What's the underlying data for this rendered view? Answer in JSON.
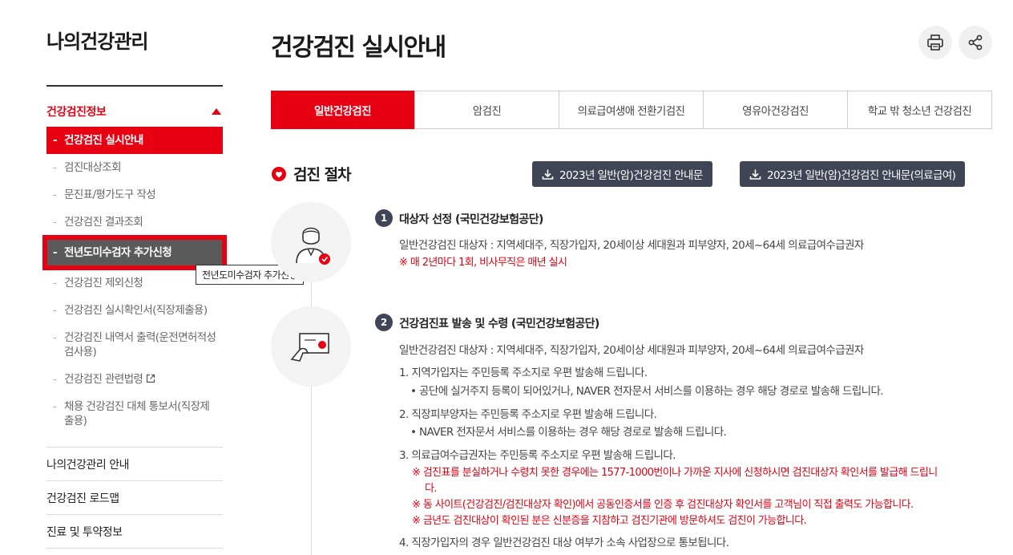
{
  "sidebar": {
    "title": "나의건강관리",
    "section": "건강검진정보",
    "items": [
      {
        "label": "건강검진 실시안내"
      },
      {
        "label": "검진대상조회"
      },
      {
        "label": "문진표/평가도구 작성"
      },
      {
        "label": "건강검진 결과조회"
      },
      {
        "label": "전년도미수검자 추가신청"
      },
      {
        "label": "건강검진 제외신청"
      },
      {
        "label": "건강검진 실시확인서(직장제출용)"
      },
      {
        "label": "건강검진 내역서 출력(운전면허적성검사용)"
      },
      {
        "label": "건강검진 관련법령"
      },
      {
        "label": "채용 건강검진 대체 통보서(직장제출용)"
      }
    ],
    "tooltip": "전년도미수검자 추가신청",
    "links": [
      "나의건강관리 안내",
      "건강검진 로드맵",
      "진료 및 투약정보"
    ]
  },
  "main": {
    "title": "건강검진 실시안내",
    "tabs": [
      {
        "label": "일반건강검진"
      },
      {
        "label": "암검진"
      },
      {
        "label": "의료급여생애 전환기검진"
      },
      {
        "label": "영유아건강검진"
      },
      {
        "label": "학교 밖 청소년 건강검진"
      }
    ],
    "section_title": "검진 절차",
    "download_buttons": [
      {
        "label": "2023년 일반(암)건강검진 안내문"
      },
      {
        "label": "2023년 일반(암)건강검진 안내문(의료급여)"
      }
    ],
    "steps": [
      {
        "num": "1",
        "title": "대상자 선정 (국민건강보험공단)",
        "line1": "일반건강검진 대상자 : 지역세대주, 직장가입자, 20세이상 세대원과 피부양자, 20세~64세 의료급여수급권자",
        "note": "※ 매 2년마다 1회, 비사무직은 매년 실시"
      },
      {
        "num": "2",
        "title": "건강검진표 발송 및 수령 (국민건강보험공단)",
        "line1": "일반건강검진 대상자 : 지역세대주, 직장가입자, 20세이상 세대원과 피부양자, 20세~64세 의료급여수급권자",
        "p1": "1. 지역가입자는 주민등록 주소지로 우편 발송해 드립니다.",
        "p1b": "• 공단에 실거주지 등록이 되어있거나, NAVER 전자문서 서비스를 이용하는 경우 해당 경로로 발송해 드립니다.",
        "p2": "2. 직장피부양자는 주민등록 주소지로 우편 발송해 드립니다.",
        "p2b": "• NAVER 전자문서 서비스를 이용하는 경우 해당 경로로 발송해 드립니다.",
        "p3": "3. 의료급여수급권자는 주민등록 주소지로 우편 발송해 드립니다.",
        "n1a": "※ 검진표를 분실하거나 수령치 못한 경우에는 1577-1000번이나 가까운 지사에 신청하시면 검진대상자 확인서를 발급해 드립니",
        "n1b": "다.",
        "n2": "※ 동 사이트(건강검진/검진대상자 확인)에서 공동인증서를 인증 후 검진대상자 확인서를 고객님이 직접 출력도 가능합니다.",
        "n3": "※ 금년도 검진대상이 확인된 분은 신분증을 지참하고 검진기관에 방문하셔도 검진이 가능합니다.",
        "p4": "4. 직장가입자의 경우 일반건강검진 대상 여부가 소속 사업장으로 통보됩니다."
      }
    ]
  },
  "colors": {
    "accent": "#e60012",
    "dark_button": "#3f4555"
  },
  "icons": [
    "print-icon",
    "share-icon",
    "download-icon",
    "heart-pin-icon",
    "doctor-icon",
    "card-icon",
    "external-link-icon"
  ]
}
